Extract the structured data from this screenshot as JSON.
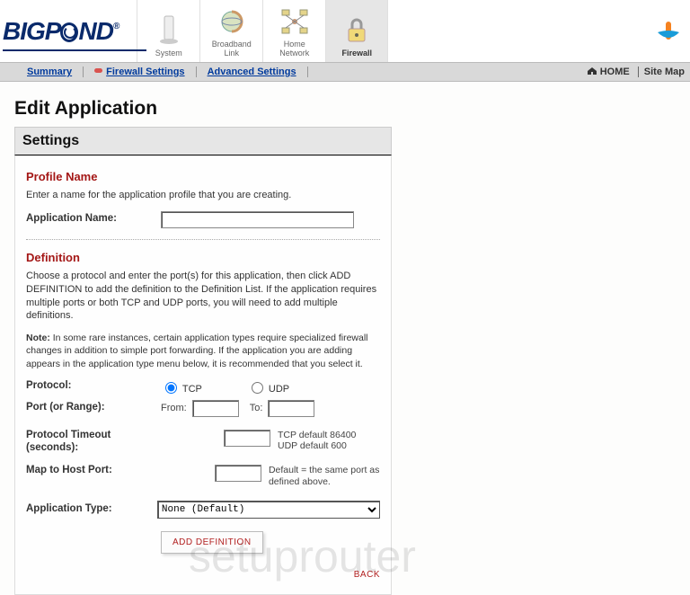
{
  "brand": "BIGPOND",
  "nav": [
    {
      "label": "System"
    },
    {
      "label": "Broadband\nLink"
    },
    {
      "label": "Home\nNetwork"
    },
    {
      "label": "Firewall"
    }
  ],
  "subnav": {
    "summary": "Summary",
    "firewall_settings": "Firewall Settings",
    "advanced_settings": "Advanced Settings",
    "home": "HOME",
    "sitemap": "Site Map"
  },
  "page_title": "Edit Application",
  "settings_header": "Settings",
  "profile": {
    "title": "Profile Name",
    "desc": "Enter a name for the application profile that you are creating.",
    "app_name_label": "Application Name:",
    "app_name_value": ""
  },
  "definition": {
    "title": "Definition",
    "desc": "Choose a protocol and enter the port(s) for this application, then click ADD DEFINITION to add the definition to the Definition List. If the application requires multiple ports or both TCP and UDP ports, you will need to add multiple definitions.",
    "note_prefix": "Note:",
    "note": " In some rare instances, certain application types require specialized firewall changes in addition to simple port forwarding. If the application you are adding appears in the application type menu below, it is recommended that you select it.",
    "protocol_label": "Protocol:",
    "protocol_tcp": "TCP",
    "protocol_udp": "UDP",
    "port_label": "Port (or Range):",
    "from_label": "From:",
    "to_label": "To:",
    "from_value": "",
    "to_value": "",
    "timeout_label": "Protocol Timeout (seconds):",
    "timeout_value": "",
    "timeout_hint": "TCP default 86400\nUDP default 600",
    "map_label": "Map to Host Port:",
    "map_value": "",
    "map_hint": "Default = the same port as defined above.",
    "apptype_label": "Application Type:",
    "apptype_options": [
      "None (Default)"
    ],
    "apptype_selected": "None (Default)",
    "add_btn": "ADD DEFINITION"
  },
  "back_btn": "BACK",
  "watermark": "setuprouter"
}
